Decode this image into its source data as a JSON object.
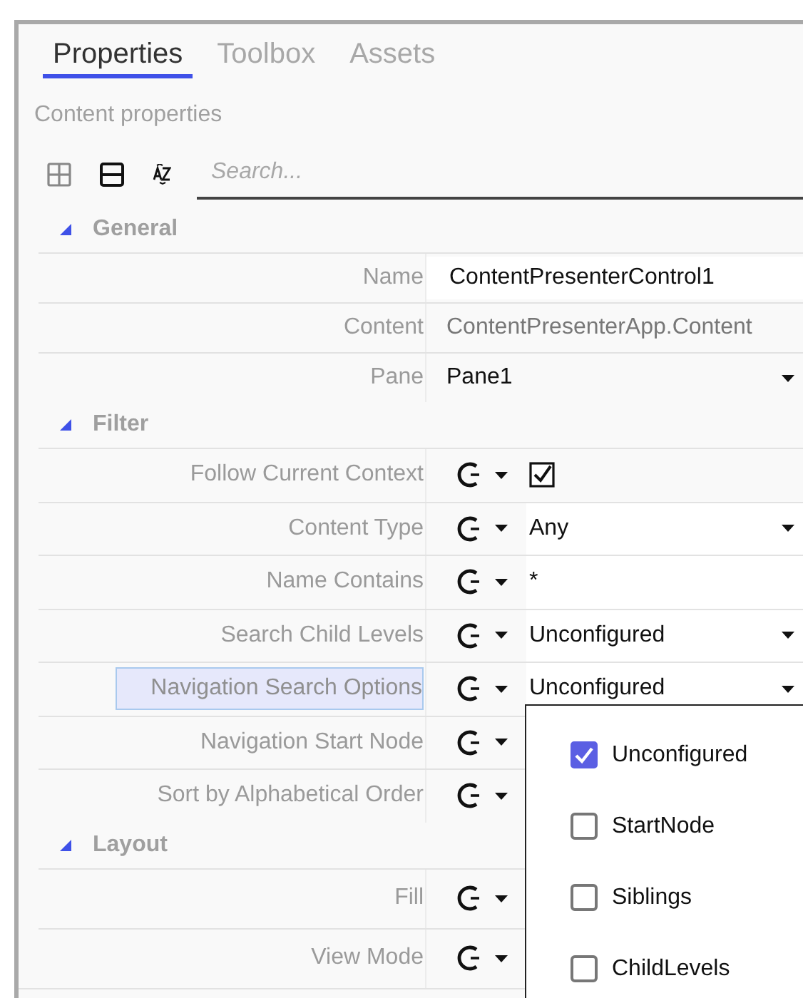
{
  "tabs": [
    {
      "label": "Properties",
      "selected": true
    },
    {
      "label": "Toolbox",
      "selected": false
    },
    {
      "label": "Assets",
      "selected": false
    }
  ],
  "subtitle": "Content properties",
  "search": {
    "placeholder": "Search..."
  },
  "sections": [
    {
      "title": "General",
      "expanded": true,
      "rows": [
        {
          "label": "Name",
          "selected": false,
          "kind": "text",
          "value": "ContentPresenterControl1"
        },
        {
          "label": "Content",
          "selected": false,
          "kind": "readonly",
          "value": "ContentPresenterApp.Content"
        },
        {
          "label": "Pane",
          "selected": false,
          "kind": "dropdown",
          "value": "Pane1"
        }
      ]
    },
    {
      "title": "Filter",
      "expanded": true,
      "rows": [
        {
          "label": "Follow Current Context",
          "selected": false,
          "kind": "bound-checkbox",
          "checked": true
        },
        {
          "label": "Content Type",
          "selected": false,
          "kind": "bound-dropdown",
          "value": "Any"
        },
        {
          "label": "Name Contains",
          "selected": false,
          "kind": "bound-text",
          "value": "*"
        },
        {
          "label": "Search Child Levels",
          "selected": false,
          "kind": "bound-dropdown",
          "value": "Unconfigured"
        },
        {
          "label": "Navigation Search Options",
          "selected": true,
          "kind": "bound-dropdown",
          "value": "Unconfigured"
        },
        {
          "label": "Navigation Start Node",
          "selected": false,
          "kind": "bound"
        },
        {
          "label": "Sort by Alphabetical Order",
          "selected": false,
          "kind": "bound"
        }
      ]
    },
    {
      "title": "Layout",
      "expanded": true,
      "rows": [
        {
          "label": "Fill",
          "selected": false,
          "kind": "bound"
        },
        {
          "label": "View Mode",
          "selected": false,
          "kind": "bound"
        }
      ]
    }
  ],
  "popup": {
    "options": [
      {
        "label": "Unconfigured",
        "checked": true
      },
      {
        "label": "StartNode",
        "checked": false
      },
      {
        "label": "Siblings",
        "checked": false
      },
      {
        "label": "ChildLevels",
        "checked": false
      }
    ]
  }
}
